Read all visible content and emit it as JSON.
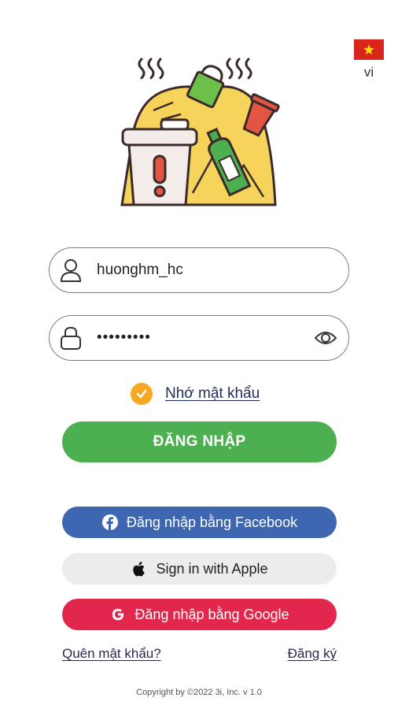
{
  "language": {
    "code": "vi"
  },
  "login_form": {
    "username_value": "huonghm_hc",
    "password_value": "•••••••••",
    "remember_label": "Nhớ mật khẩu",
    "remember_checked": true,
    "login_button": "ĐĂNG NHẬP"
  },
  "social": {
    "facebook_label": "Đăng nhập bằng Facebook",
    "apple_label": "Sign in with Apple",
    "google_label": "Đăng nhập bằng Google"
  },
  "links": {
    "forgot_password": "Quên mật khẩu?",
    "register": "Đăng ký"
  },
  "footer": {
    "copyright": "Copyright by ©2022 3i, Inc. v 1.0"
  },
  "colors": {
    "primary_green": "#4caf50",
    "facebook_blue": "#3f66b0",
    "google_red": "#e3264c",
    "remember_orange": "#f7a823",
    "flag_red": "#da251d",
    "flag_star": "#ffde00"
  },
  "icons": {
    "flag": "vietnam-flag-icon",
    "user": "user-icon",
    "lock": "lock-icon",
    "eye": "eye-icon",
    "check": "check-icon",
    "facebook": "facebook-icon",
    "apple": "apple-icon",
    "google": "google-icon",
    "logo": "waste-pile-logo"
  }
}
